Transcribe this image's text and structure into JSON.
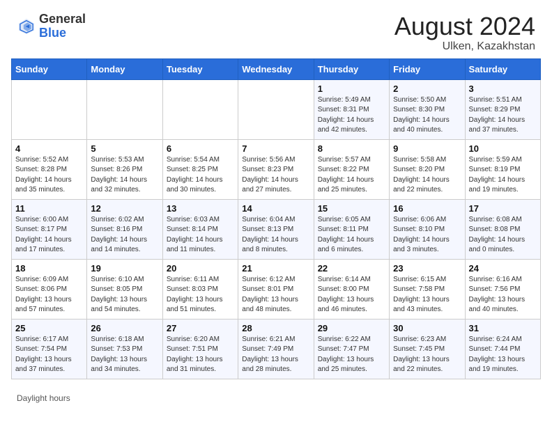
{
  "header": {
    "logo_general": "General",
    "logo_blue": "Blue",
    "month_year": "August 2024",
    "location": "Ulken, Kazakhstan"
  },
  "days_of_week": [
    "Sunday",
    "Monday",
    "Tuesday",
    "Wednesday",
    "Thursday",
    "Friday",
    "Saturday"
  ],
  "weeks": [
    [
      {
        "num": "",
        "info": ""
      },
      {
        "num": "",
        "info": ""
      },
      {
        "num": "",
        "info": ""
      },
      {
        "num": "",
        "info": ""
      },
      {
        "num": "1",
        "info": "Sunrise: 5:49 AM\nSunset: 8:31 PM\nDaylight: 14 hours and 42 minutes."
      },
      {
        "num": "2",
        "info": "Sunrise: 5:50 AM\nSunset: 8:30 PM\nDaylight: 14 hours and 40 minutes."
      },
      {
        "num": "3",
        "info": "Sunrise: 5:51 AM\nSunset: 8:29 PM\nDaylight: 14 hours and 37 minutes."
      }
    ],
    [
      {
        "num": "4",
        "info": "Sunrise: 5:52 AM\nSunset: 8:28 PM\nDaylight: 14 hours and 35 minutes."
      },
      {
        "num": "5",
        "info": "Sunrise: 5:53 AM\nSunset: 8:26 PM\nDaylight: 14 hours and 32 minutes."
      },
      {
        "num": "6",
        "info": "Sunrise: 5:54 AM\nSunset: 8:25 PM\nDaylight: 14 hours and 30 minutes."
      },
      {
        "num": "7",
        "info": "Sunrise: 5:56 AM\nSunset: 8:23 PM\nDaylight: 14 hours and 27 minutes."
      },
      {
        "num": "8",
        "info": "Sunrise: 5:57 AM\nSunset: 8:22 PM\nDaylight: 14 hours and 25 minutes."
      },
      {
        "num": "9",
        "info": "Sunrise: 5:58 AM\nSunset: 8:20 PM\nDaylight: 14 hours and 22 minutes."
      },
      {
        "num": "10",
        "info": "Sunrise: 5:59 AM\nSunset: 8:19 PM\nDaylight: 14 hours and 19 minutes."
      }
    ],
    [
      {
        "num": "11",
        "info": "Sunrise: 6:00 AM\nSunset: 8:17 PM\nDaylight: 14 hours and 17 minutes."
      },
      {
        "num": "12",
        "info": "Sunrise: 6:02 AM\nSunset: 8:16 PM\nDaylight: 14 hours and 14 minutes."
      },
      {
        "num": "13",
        "info": "Sunrise: 6:03 AM\nSunset: 8:14 PM\nDaylight: 14 hours and 11 minutes."
      },
      {
        "num": "14",
        "info": "Sunrise: 6:04 AM\nSunset: 8:13 PM\nDaylight: 14 hours and 8 minutes."
      },
      {
        "num": "15",
        "info": "Sunrise: 6:05 AM\nSunset: 8:11 PM\nDaylight: 14 hours and 6 minutes."
      },
      {
        "num": "16",
        "info": "Sunrise: 6:06 AM\nSunset: 8:10 PM\nDaylight: 14 hours and 3 minutes."
      },
      {
        "num": "17",
        "info": "Sunrise: 6:08 AM\nSunset: 8:08 PM\nDaylight: 14 hours and 0 minutes."
      }
    ],
    [
      {
        "num": "18",
        "info": "Sunrise: 6:09 AM\nSunset: 8:06 PM\nDaylight: 13 hours and 57 minutes."
      },
      {
        "num": "19",
        "info": "Sunrise: 6:10 AM\nSunset: 8:05 PM\nDaylight: 13 hours and 54 minutes."
      },
      {
        "num": "20",
        "info": "Sunrise: 6:11 AM\nSunset: 8:03 PM\nDaylight: 13 hours and 51 minutes."
      },
      {
        "num": "21",
        "info": "Sunrise: 6:12 AM\nSunset: 8:01 PM\nDaylight: 13 hours and 48 minutes."
      },
      {
        "num": "22",
        "info": "Sunrise: 6:14 AM\nSunset: 8:00 PM\nDaylight: 13 hours and 46 minutes."
      },
      {
        "num": "23",
        "info": "Sunrise: 6:15 AM\nSunset: 7:58 PM\nDaylight: 13 hours and 43 minutes."
      },
      {
        "num": "24",
        "info": "Sunrise: 6:16 AM\nSunset: 7:56 PM\nDaylight: 13 hours and 40 minutes."
      }
    ],
    [
      {
        "num": "25",
        "info": "Sunrise: 6:17 AM\nSunset: 7:54 PM\nDaylight: 13 hours and 37 minutes."
      },
      {
        "num": "26",
        "info": "Sunrise: 6:18 AM\nSunset: 7:53 PM\nDaylight: 13 hours and 34 minutes."
      },
      {
        "num": "27",
        "info": "Sunrise: 6:20 AM\nSunset: 7:51 PM\nDaylight: 13 hours and 31 minutes."
      },
      {
        "num": "28",
        "info": "Sunrise: 6:21 AM\nSunset: 7:49 PM\nDaylight: 13 hours and 28 minutes."
      },
      {
        "num": "29",
        "info": "Sunrise: 6:22 AM\nSunset: 7:47 PM\nDaylight: 13 hours and 25 minutes."
      },
      {
        "num": "30",
        "info": "Sunrise: 6:23 AM\nSunset: 7:45 PM\nDaylight: 13 hours and 22 minutes."
      },
      {
        "num": "31",
        "info": "Sunrise: 6:24 AM\nSunset: 7:44 PM\nDaylight: 13 hours and 19 minutes."
      }
    ]
  ],
  "footer": "Daylight hours"
}
